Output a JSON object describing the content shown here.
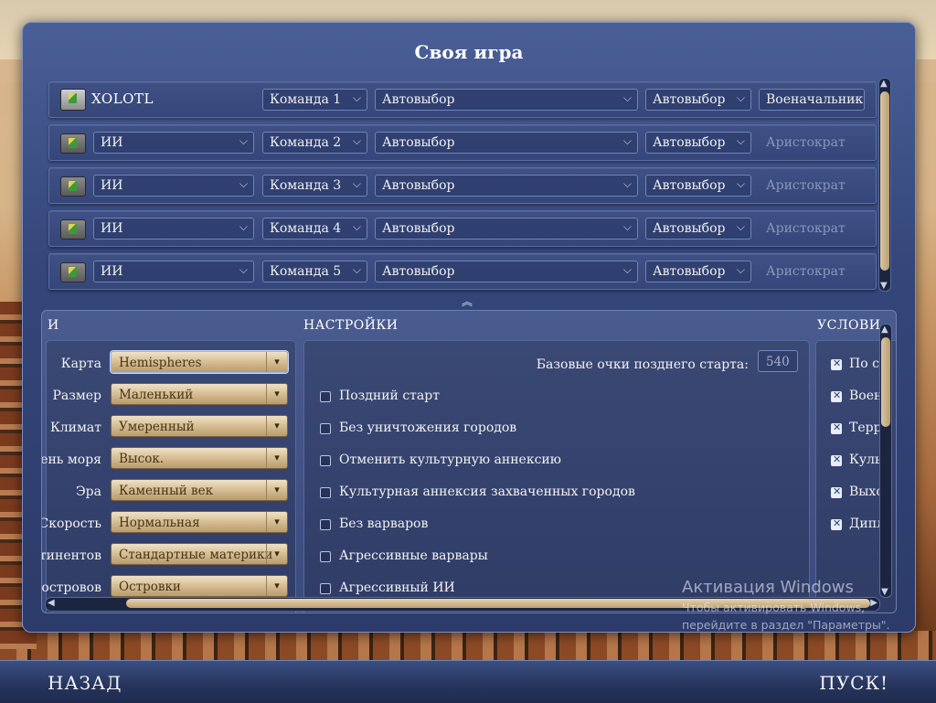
{
  "title": "Своя игра",
  "players": [
    {
      "name": "XOLOTL",
      "team": "Команда 1",
      "civ": "Автовыбор",
      "handicap": "Автовыбор",
      "difficulty": "Военачальник"
    },
    {
      "name": "ИИ",
      "team": "Команда 2",
      "civ": "Автовыбор",
      "handicap": "Автовыбор",
      "difficulty": "Аристократ"
    },
    {
      "name": "ИИ",
      "team": "Команда 3",
      "civ": "Автовыбор",
      "handicap": "Автовыбор",
      "difficulty": "Аристократ"
    },
    {
      "name": "ИИ",
      "team": "Команда 4",
      "civ": "Автовыбор",
      "handicap": "Автовыбор",
      "difficulty": "Аристократ"
    },
    {
      "name": "ИИ",
      "team": "Команда 5",
      "civ": "Автовыбор",
      "handicap": "Автовыбор",
      "difficulty": "Аристократ"
    }
  ],
  "map_section": {
    "header": "И",
    "options": [
      {
        "label": "Карта",
        "value": "Hemispheres"
      },
      {
        "label": "Размер",
        "value": "Маленький"
      },
      {
        "label": "Климат",
        "value": "Умеренный"
      },
      {
        "label": "ень моря",
        "value": "Высок."
      },
      {
        "label": "Эра",
        "value": "Каменный век"
      },
      {
        "label": "Скорость",
        "value": "Нормальная"
      },
      {
        "label": "тинентов",
        "value": "Стандартные материки"
      },
      {
        "label": "островов",
        "value": "Островки"
      }
    ]
  },
  "settings_section": {
    "header": "НАСТРОЙКИ",
    "late_start_label": "Базовые очки позднего старта:",
    "late_start_value": "540",
    "options": [
      {
        "label": "Поздний старт",
        "checked": false
      },
      {
        "label": "Без уничтожения городов",
        "checked": false
      },
      {
        "label": "Отменить культурную аннексию",
        "checked": false
      },
      {
        "label": "Культурная аннексия захваченных городов",
        "checked": false
      },
      {
        "label": "Без варваров",
        "checked": false
      },
      {
        "label": "Агрессивные варвары",
        "checked": false
      },
      {
        "label": "Агрессивный ИИ",
        "checked": false
      }
    ]
  },
  "victory_section": {
    "header": "УСЛОВИ",
    "options": [
      {
        "label": "По с",
        "checked": true
      },
      {
        "label": "Воен",
        "checked": true
      },
      {
        "label": "Терр",
        "checked": true
      },
      {
        "label": "Куль",
        "checked": true
      },
      {
        "label": "Выхо",
        "checked": true
      },
      {
        "label": "Дипл",
        "checked": true
      }
    ]
  },
  "bottom": {
    "back": "НАЗАД",
    "start": "ПУСК!"
  },
  "watermark": {
    "line1": "Активация Windows",
    "line2": "Чтобы активировать Windows,",
    "line3": "перейдите в раздел \"Параметры\"."
  },
  "icons": {
    "chevron": "chevron-down-icon",
    "leader": "leader-portrait-icon"
  }
}
